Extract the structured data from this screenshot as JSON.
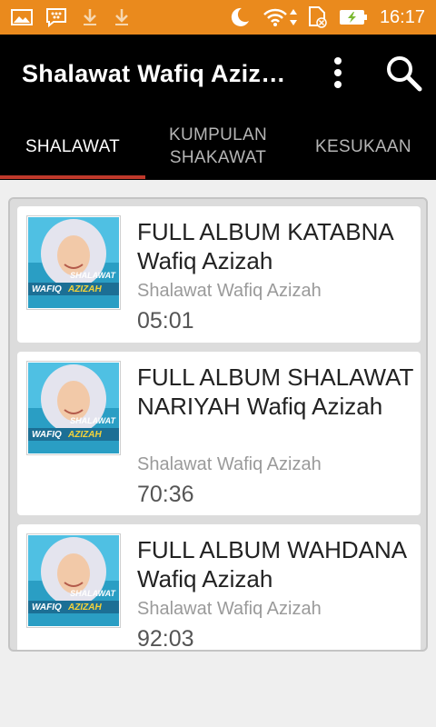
{
  "status_bar": {
    "time": "16:17",
    "icons": [
      "gallery-icon",
      "bbm-icon",
      "download-icon",
      "download-icon",
      "moon-icon",
      "wifi-icon",
      "data-arrows-icon",
      "sim-blocked-icon",
      "battery-charging-icon"
    ]
  },
  "app_bar": {
    "title": "Shalawat Wafiq Aziz…",
    "overflow_icon": "more-vert-icon",
    "search_icon": "search-icon"
  },
  "tabs": [
    {
      "label": "SHALAWAT",
      "active": true
    },
    {
      "label": "KUMPULAN SHAKAWAT",
      "active": false
    },
    {
      "label": "KESUKAAN",
      "active": false
    }
  ],
  "songs": [
    {
      "title": "FULL ALBUM KATABNA Wafiq Azizah",
      "artist": "Shalawat Wafiq Azizah",
      "duration": "05:01"
    },
    {
      "title": "FULL ALBUM SHALAWAT NARIYAH Wafiq Azizah",
      "artist": "Shalawat Wafiq Azizah",
      "duration": "70:36"
    },
    {
      "title": "FULL ALBUM WAHDANA Wafiq Azizah",
      "artist": "Shalawat Wafiq Azizah",
      "duration": "92:03"
    }
  ],
  "thumbnail_text": {
    "line1": "SHALAWAT",
    "line2a": "WAFIQ",
    "line2b": "AZIZAH"
  },
  "colors": {
    "status_bar": "#ea8a1d",
    "app_bar": "#000000",
    "tab_indicator": "#c0392b"
  }
}
